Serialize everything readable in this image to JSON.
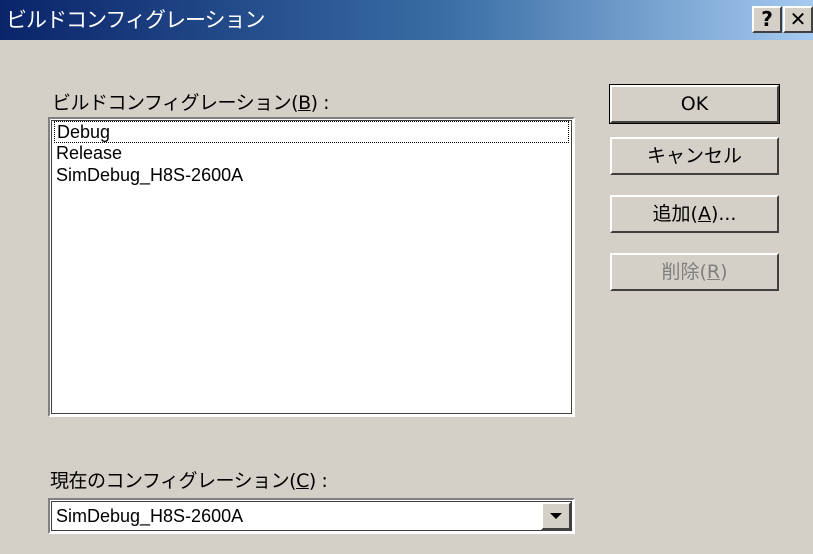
{
  "window": {
    "title": "ビルドコンフィグレーション",
    "help_label": "?",
    "close_label": "✕"
  },
  "build_config": {
    "label_prefix": "ビルドコンフィグレーション(",
    "label_mnemonic": "B",
    "label_suffix": ") :",
    "items": [
      "Debug",
      "Release",
      "SimDebug_H8S-2600A"
    ],
    "focused_index": 0
  },
  "buttons": {
    "ok": "OK",
    "cancel": "キャンセル",
    "add_prefix": "追加(",
    "add_mnemonic": "A",
    "add_suffix": ")...",
    "delete_prefix": "削除(",
    "delete_mnemonic": "R",
    "delete_suffix": ")"
  },
  "current_config": {
    "label_prefix": "現在のコンフィグレーション(",
    "label_mnemonic": "C",
    "label_suffix": ") :",
    "value": "SimDebug_H8S-2600A"
  }
}
